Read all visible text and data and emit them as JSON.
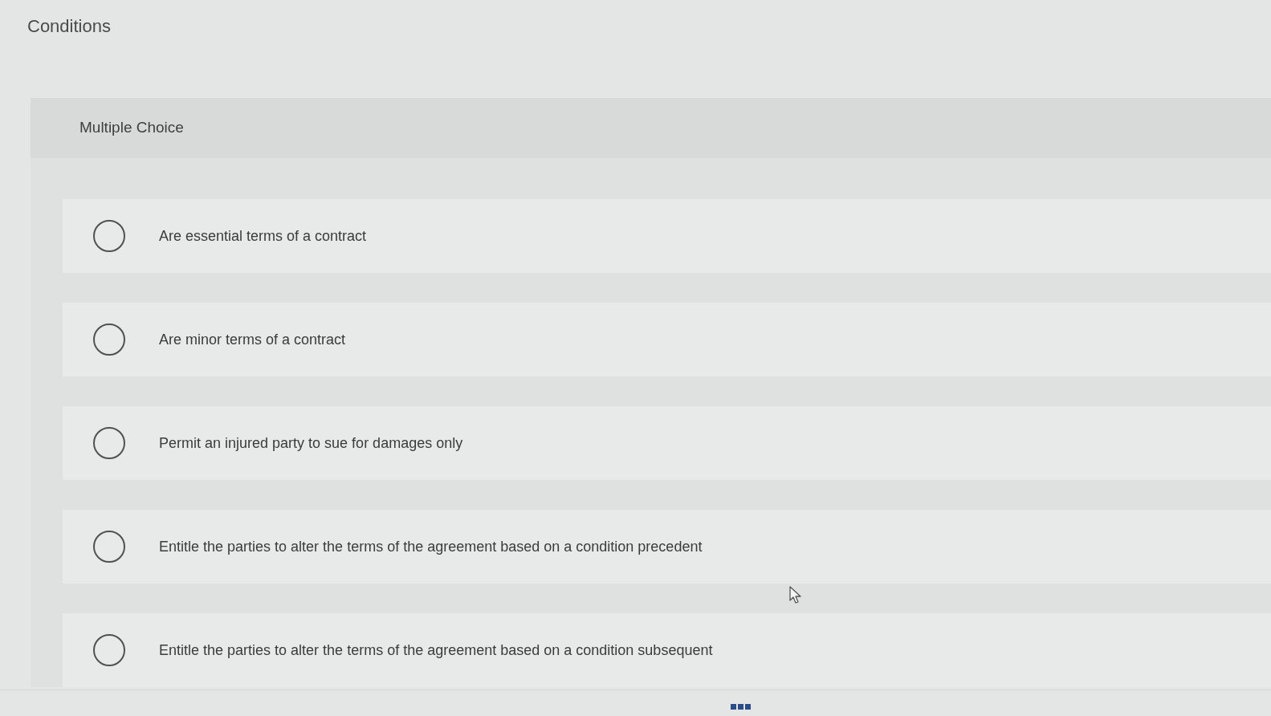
{
  "page_title": "Conditions",
  "question": {
    "type_label": "Multiple Choice",
    "options": [
      {
        "text": "Are essential terms of a contract",
        "selected": false
      },
      {
        "text": "Are minor terms of a contract",
        "selected": false
      },
      {
        "text": "Permit an injured party to sue for damages only",
        "selected": false
      },
      {
        "text": "Entitle the parties to alter the terms of the agreement based on a condition precedent",
        "selected": false
      },
      {
        "text": "Entitle the parties to alter the terms of the agreement based on a condition subsequent",
        "selected": false
      }
    ]
  }
}
